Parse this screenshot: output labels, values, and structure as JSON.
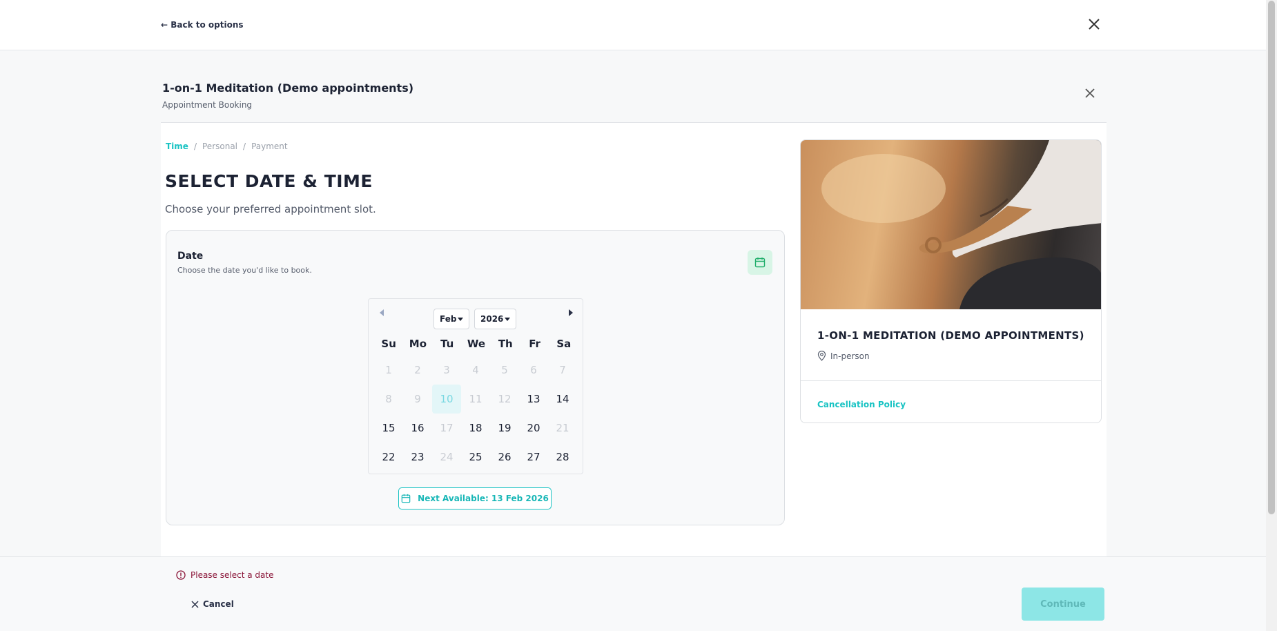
{
  "topbar": {
    "back_label": "← Back to options"
  },
  "modal": {
    "title": "1-on-1 Meditation (Demo appointments)",
    "subtitle": "Appointment Booking"
  },
  "breadcrumb": {
    "step1": "Time",
    "sep": "/",
    "step2": "Personal",
    "step3": "Payment"
  },
  "step": {
    "title": "SELECT DATE & TIME",
    "description": "Choose your preferred appointment slot."
  },
  "date_card": {
    "title": "Date",
    "subtitle": "Choose the date you'd like to book.",
    "icon": "calendar-icon",
    "accent": "#19c3c3"
  },
  "calendar": {
    "month": "Feb",
    "year": "2026",
    "weekdays": [
      "Su",
      "Mo",
      "Tu",
      "We",
      "Th",
      "Fr",
      "Sa"
    ],
    "days": [
      {
        "n": "1",
        "s": "disabled"
      },
      {
        "n": "2",
        "s": "disabled"
      },
      {
        "n": "3",
        "s": "disabled"
      },
      {
        "n": "4",
        "s": "disabled"
      },
      {
        "n": "5",
        "s": "disabled"
      },
      {
        "n": "6",
        "s": "disabled"
      },
      {
        "n": "7",
        "s": "disabled"
      },
      {
        "n": "8",
        "s": "disabled"
      },
      {
        "n": "9",
        "s": "disabled"
      },
      {
        "n": "10",
        "s": "today"
      },
      {
        "n": "11",
        "s": "disabled"
      },
      {
        "n": "12",
        "s": "disabled"
      },
      {
        "n": "13",
        "s": "available"
      },
      {
        "n": "14",
        "s": "available"
      },
      {
        "n": "15",
        "s": "available"
      },
      {
        "n": "16",
        "s": "available"
      },
      {
        "n": "17",
        "s": "disabled"
      },
      {
        "n": "18",
        "s": "available"
      },
      {
        "n": "19",
        "s": "available"
      },
      {
        "n": "20",
        "s": "available"
      },
      {
        "n": "21",
        "s": "disabled"
      },
      {
        "n": "22",
        "s": "available"
      },
      {
        "n": "23",
        "s": "available"
      },
      {
        "n": "24",
        "s": "disabled"
      },
      {
        "n": "25",
        "s": "available"
      },
      {
        "n": "26",
        "s": "available"
      },
      {
        "n": "27",
        "s": "available"
      },
      {
        "n": "28",
        "s": "available"
      }
    ],
    "next_available_label": "Next Available: 13 Feb 2026"
  },
  "info_card": {
    "title": "1-ON-1 MEDITATION (DEMO APPOINTMENTS)",
    "location": "In-person",
    "policy_link": "Cancellation Policy"
  },
  "footer": {
    "error": "Please select a date",
    "cancel_label": "Cancel",
    "continue_label": "Continue",
    "error_color": "#8a1538"
  }
}
